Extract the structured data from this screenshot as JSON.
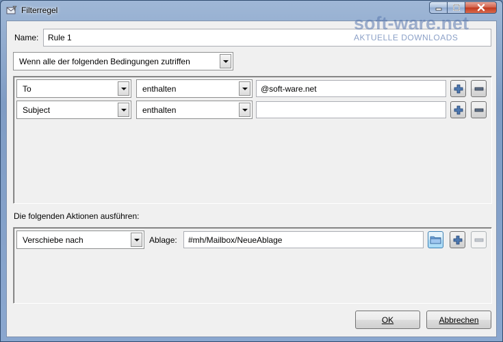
{
  "window": {
    "title": "Filterregel"
  },
  "name_row": {
    "label": "Name:",
    "value": "Rule 1"
  },
  "match_mode": {
    "selected": "Wenn alle der folgenden Bedingungen zutriffen"
  },
  "conditions": [
    {
      "field": "To",
      "operator": "enthalten",
      "value": "@soft-ware.net"
    },
    {
      "field": "Subject",
      "operator": "enthalten",
      "value": ""
    }
  ],
  "actions_heading": "Die folgenden Aktionen ausführen:",
  "actions": [
    {
      "action": "Verschiebe nach",
      "target_label": "Ablage:",
      "target_value": "#mh/Mailbox/NeueAblage"
    }
  ],
  "buttons": {
    "ok": "OK",
    "cancel": "Abbrechen"
  },
  "watermark": {
    "main": "soft-ware.net",
    "sub": "AKTUELLE DOWNLOADS"
  },
  "icons": {
    "add": "plus-icon",
    "remove": "minus-icon",
    "browse": "folder-icon"
  }
}
